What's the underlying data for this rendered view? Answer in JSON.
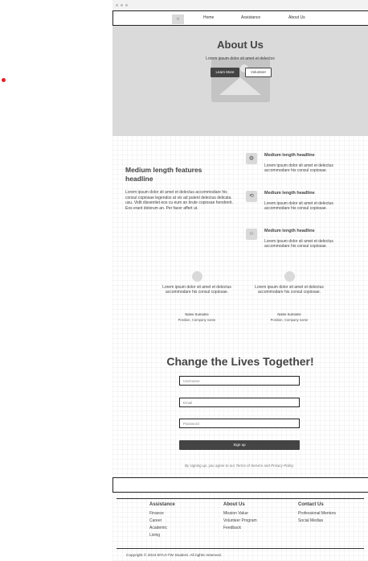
{
  "nav": {
    "logo": "□",
    "links": [
      "Home",
      "Assistance",
      "About Us"
    ]
  },
  "hero": {
    "title": "About Us",
    "subtitle": "Lorem ipsum dolor sit amet et delectus",
    "primary_button": "Learn More",
    "secondary_button": "Volunteer"
  },
  "features": {
    "headline": "Medium length features headline",
    "body": "Lorem ipsum dolor sit amet et delectus accommodare his consul copiosae legendos at vix ad putent delectus delicata usu. Vidit dissentiet eos cu eum an brute copiosae hendrerit. Eos erant dolorum an. Per facer affert ut.",
    "items": [
      {
        "icon": "globe-icon",
        "glyph": "◍",
        "title": "Medium length headline",
        "text": "Lorem ipsum dolor sit amet et delectus accommodare his consul copiosae."
      },
      {
        "icon": "refresh-icon",
        "glyph": "⟲",
        "title": "Medium length headline",
        "text": "Lorem ipsum dolor sit amet et delectus accommodare his consul copiosae."
      },
      {
        "icon": "star-icon",
        "glyph": "☆",
        "title": "Medium length headline",
        "text": "Lorem ipsum dolor sit amet et delectus accommodare his consul copiosae."
      }
    ]
  },
  "testimonials": [
    {
      "quote": "Lorem ipsum dolor sit amet et delectus accommodare his consul copiosae.",
      "name": "Name Surname",
      "position": "Position, Company name"
    },
    {
      "quote": "Lorem ipsum dolor sit amet et delectus accommodare his consul copiosae.",
      "name": "Name Surname",
      "position": "Position, Company name"
    }
  ],
  "signup": {
    "title": "Change the Lives Together!",
    "username_placeholder": "Username",
    "email_placeholder": "Email",
    "password_placeholder": "Password",
    "button": "Sign up",
    "terms": "By signing up, you agree to our Terms of Service and Privacy Policy."
  },
  "footer": {
    "columns": [
      {
        "title": "Assistance",
        "links": [
          "Finance",
          "Career",
          "Academic",
          "Living"
        ]
      },
      {
        "title": "About Us",
        "links": [
          "Mission Value",
          "Volunteer Program",
          "Feedback"
        ]
      },
      {
        "title": "Contact Us",
        "links": [
          "Professional Mentors",
          "Social Medias"
        ]
      }
    ],
    "copyright": "Copyright © 2024 BYUI-TW Student. All rights reserved."
  },
  "colors": {
    "accent_dark": "#444444",
    "hero_bg": "#dadada",
    "marker_red": "#e0202a"
  }
}
